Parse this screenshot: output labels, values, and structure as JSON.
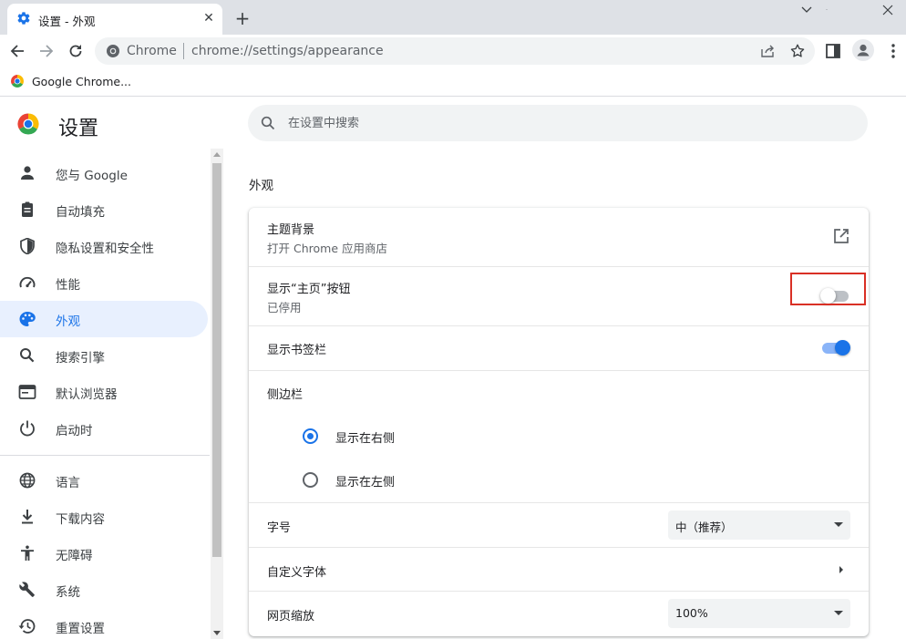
{
  "window": {
    "tab_title": "设置 - 外观",
    "tab_close": "✕",
    "new_tab": "+"
  },
  "toolbar": {
    "omnibox_site": "Chrome",
    "omnibox_url": "chrome://settings/appearance"
  },
  "bookmarks": {
    "items": [
      {
        "label": "Google Chrome..."
      }
    ]
  },
  "page": {
    "title": "设置",
    "search_placeholder": "在设置中搜索"
  },
  "sidebar": {
    "items": [
      {
        "label": "您与 Google",
        "icon": "person-icon",
        "active": false
      },
      {
        "label": "自动填充",
        "icon": "clipboard-icon",
        "active": false
      },
      {
        "label": "隐私设置和安全性",
        "icon": "shield-icon",
        "active": false
      },
      {
        "label": "性能",
        "icon": "speedometer-icon",
        "active": false
      },
      {
        "label": "外观",
        "icon": "palette-icon",
        "active": true
      },
      {
        "label": "搜索引擎",
        "icon": "search-icon",
        "active": false
      },
      {
        "label": "默认浏览器",
        "icon": "browser-icon",
        "active": false
      },
      {
        "label": "启动时",
        "icon": "power-icon",
        "active": false
      },
      {
        "label": "语言",
        "icon": "globe-icon",
        "active": false
      },
      {
        "label": "下载内容",
        "icon": "download-icon",
        "active": false
      },
      {
        "label": "无障碍",
        "icon": "accessibility-icon",
        "active": false
      },
      {
        "label": "系统",
        "icon": "wrench-icon",
        "active": false
      },
      {
        "label": "重置设置",
        "icon": "reset-icon",
        "active": false
      }
    ]
  },
  "appearance": {
    "section_title": "外观",
    "theme": {
      "label": "主题背景",
      "sub": "打开 Chrome 应用商店"
    },
    "home_button": {
      "label": "显示“主页”按钮",
      "sub": "已停用",
      "enabled": false
    },
    "bookmarks_bar": {
      "label": "显示书签栏",
      "enabled": true
    },
    "side_panel": {
      "label": "侧边栏",
      "options": [
        {
          "label": "显示在右侧",
          "checked": true
        },
        {
          "label": "显示在左侧",
          "checked": false
        }
      ]
    },
    "font_size": {
      "label": "字号",
      "value": "中（推荐）"
    },
    "custom_fonts": {
      "label": "自定义字体"
    },
    "page_zoom": {
      "label": "网页缩放",
      "value": "100%"
    }
  },
  "colors": {
    "accent": "#1a73e8",
    "highlight": "#d93025",
    "titlebar": "#dee1e6"
  }
}
